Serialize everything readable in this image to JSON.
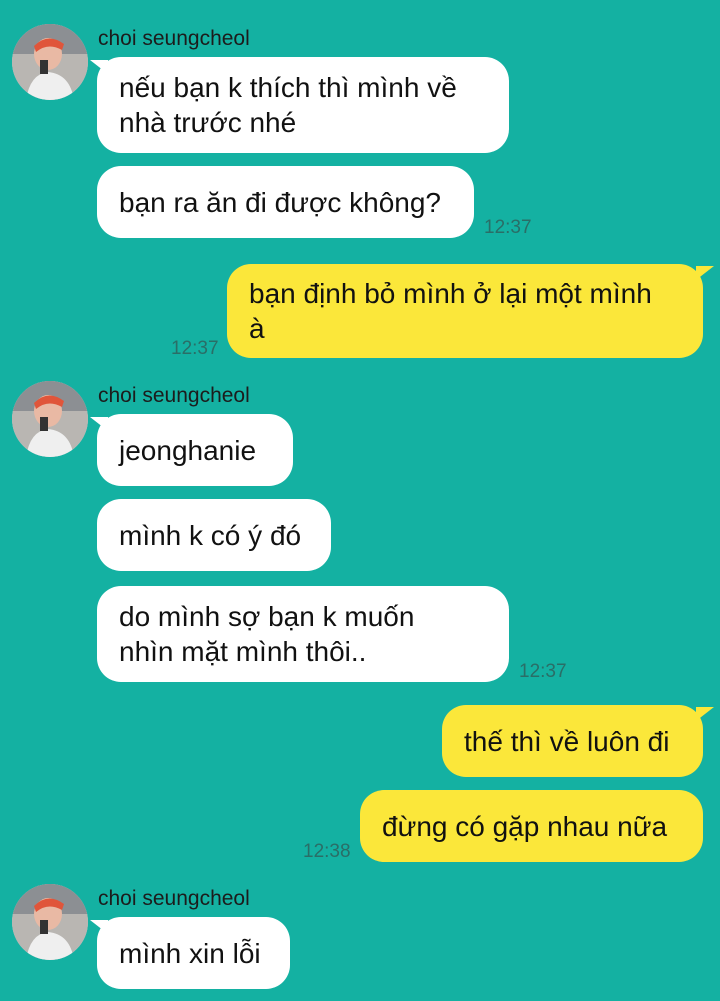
{
  "chat": {
    "contact_name": "choi seungcheol",
    "groups": [
      {
        "sender": "choi seungcheol",
        "messages": [
          {
            "text": "nếu bạn k thích thì mình về\nnhà trước nhé"
          },
          {
            "text": "bạn ra ăn đi được không?",
            "time": "12:37"
          }
        ]
      },
      {
        "sender": "me",
        "messages": [
          {
            "text": "bạn định bỏ mình ở lại một mình\nà",
            "time": "12:37"
          }
        ]
      },
      {
        "sender": "choi seungcheol",
        "messages": [
          {
            "text": "jeonghanie"
          },
          {
            "text": "mình k có ý đó"
          },
          {
            "text": "do mình sợ bạn k muốn\nnhìn mặt mình thôi..",
            "time": "12:37"
          }
        ]
      },
      {
        "sender": "me",
        "messages": [
          {
            "text": "thế thì về luôn đi"
          },
          {
            "text": "đừng có gặp nhau nữa",
            "time": "12:38"
          }
        ]
      },
      {
        "sender": "choi seungcheol",
        "messages": [
          {
            "text": "mình xin lỗi"
          }
        ]
      }
    ]
  },
  "colors": {
    "background": "#14b1a2",
    "incoming_bubble": "#ffffff",
    "outgoing_bubble": "#fbe73a"
  }
}
